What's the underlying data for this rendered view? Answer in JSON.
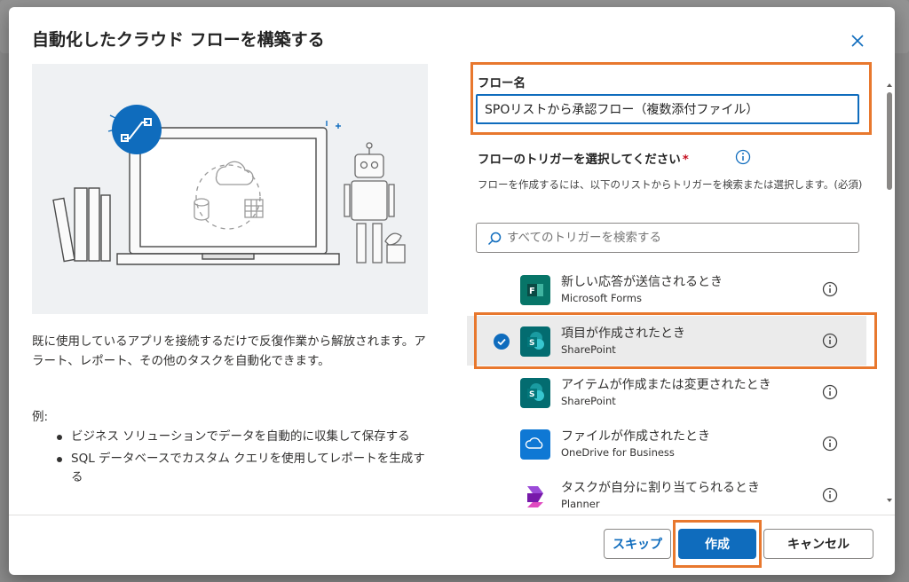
{
  "dialog": {
    "title": "自動化したクラウド フローを構築する",
    "description": "既に使用しているアプリを接続するだけで反復作業から解放されます。アラート、レポート、その他のタスクを自動化できます。",
    "example_label": "例:",
    "examples": [
      "ビジネス ソリューションでデータを自動的に収集して保存する",
      "SQL データベースでカスタム クエリを使用してレポートを生成する"
    ]
  },
  "flow_name": {
    "label": "フロー名",
    "value": "SPOリストから承認フロー（複数添付ファイル）"
  },
  "trigger": {
    "label": "フローのトリガーを選択してください",
    "required_mark": "*",
    "helper": "フローを作成するには、以下のリストからトリガーを検索または選択します。(必須)",
    "search_placeholder": "すべてのトリガーを検索する",
    "items": [
      {
        "title": "新しい応答が送信されるとき",
        "connector": "Microsoft Forms",
        "icon": "forms-icon",
        "selected": false
      },
      {
        "title": "項目が作成されたとき",
        "connector": "SharePoint",
        "icon": "sharepoint-icon",
        "selected": true
      },
      {
        "title": "アイテムが作成または変更されたとき",
        "connector": "SharePoint",
        "icon": "sharepoint-icon",
        "selected": false
      },
      {
        "title": "ファイルが作成されたとき",
        "connector": "OneDrive for Business",
        "icon": "onedrive-icon",
        "selected": false
      },
      {
        "title": "タスクが自分に割り当てられるとき",
        "connector": "Planner",
        "icon": "planner-icon",
        "selected": false
      }
    ]
  },
  "buttons": {
    "skip": "スキップ",
    "create": "作成",
    "cancel": "キャンセル"
  },
  "colors": {
    "accent": "#0f6cbd",
    "highlight": "#e8782e",
    "forms": "#077568",
    "sharepoint": "#036c70",
    "onedrive": "#0f78d4",
    "planner": "#7719aa"
  }
}
